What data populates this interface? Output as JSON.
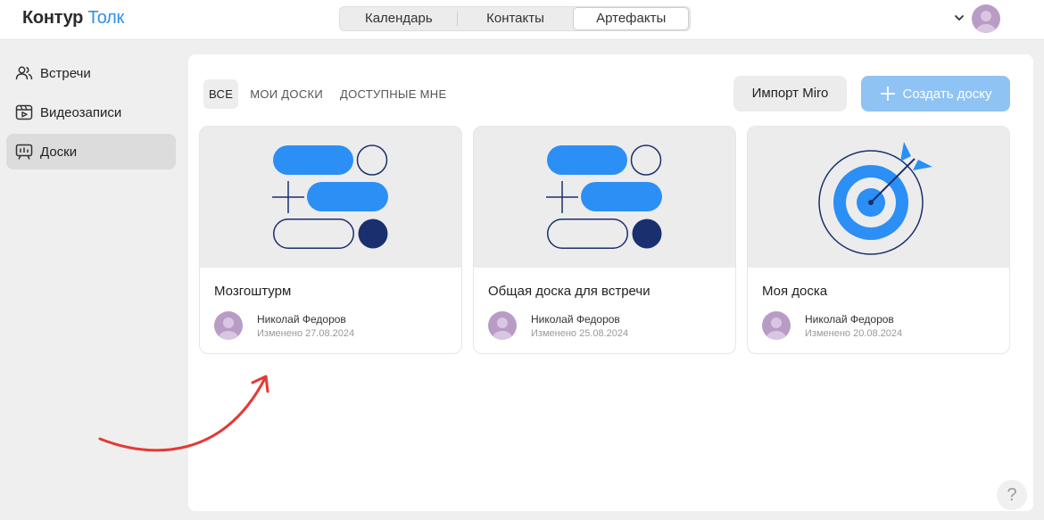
{
  "header": {
    "logo_part1": "Контур",
    "logo_part2": "Толк",
    "tabs": [
      {
        "label": "Календарь"
      },
      {
        "label": "Контакты"
      },
      {
        "label": "Артефакты"
      }
    ]
  },
  "sidebar": {
    "items": [
      {
        "label": "Встречи",
        "icon": "people-icon"
      },
      {
        "label": "Видеозаписи",
        "icon": "video-recording-icon"
      },
      {
        "label": "Доски",
        "icon": "board-icon"
      }
    ]
  },
  "main": {
    "filters": [
      "ВСЕ",
      "МОИ ДОСКИ",
      "ДОСТУПНЫЕ МНЕ"
    ],
    "import_label": "Импорт Miro",
    "create_label": "Создать доску",
    "boards": [
      {
        "title": "Мозгоштурм",
        "author": "Николай Федоров",
        "modified": "Изменено 27.08.2024",
        "thumbnail": "blocks-icon"
      },
      {
        "title": "Общая доска для встречи",
        "author": "Николай Федоров",
        "modified": "Изменено 25.08.2024",
        "thumbnail": "blocks-icon"
      },
      {
        "title": "Моя доска",
        "author": "Николай Федоров",
        "modified": "Изменено 20.08.2024",
        "thumbnail": "target-icon"
      }
    ],
    "help_label": "?"
  },
  "colors": {
    "accent": "#2f8fe8",
    "create_button": "#8fc3f3",
    "dark_navy": "#1a2f6e",
    "avatar": "#b99cc6",
    "annotation_arrow": "#e53935"
  }
}
